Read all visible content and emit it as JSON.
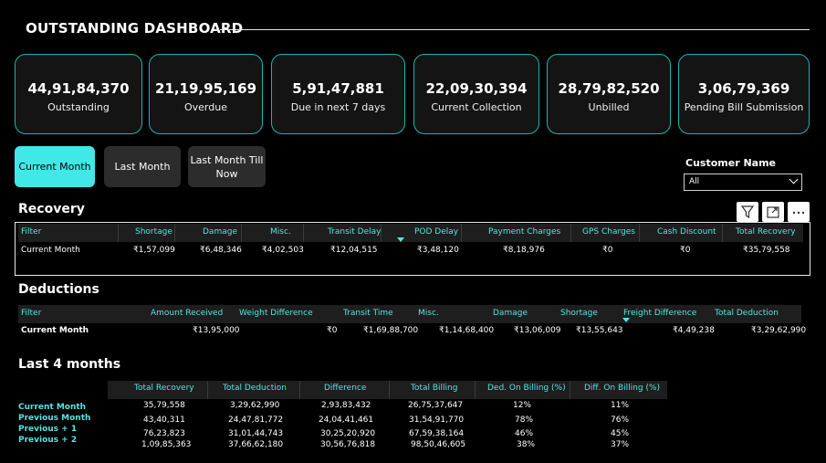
{
  "dashboard": {
    "title": "OUTSTANDING DASHBOARD"
  },
  "kpis": [
    {
      "value": "44,91,84,370",
      "label": "Outstanding"
    },
    {
      "value": "21,19,95,169",
      "label": "Overdue"
    },
    {
      "value": "5,91,47,881",
      "label": "Due in next 7 days"
    },
    {
      "value": "22,09,30,394",
      "label": "Current Collection"
    },
    {
      "value": "28,79,82,520",
      "label": "Unbilled"
    },
    {
      "value": "3,06,79,369",
      "label": "Pending Bill Submission"
    }
  ],
  "period_buttons": {
    "current": "Current Month",
    "last": "Last Month",
    "last_till_now_line1": "Last Month Till",
    "last_till_now_line2": "Now"
  },
  "slicer": {
    "label": "Customer Name",
    "value": "All"
  },
  "recovery": {
    "title": "Recovery",
    "headers": [
      "Filter",
      "Shortage",
      "Damage",
      "Misc.",
      "Transit Delay",
      "POD Delay",
      "Payment Charges",
      "GPS Charges",
      "Cash Discount",
      "Total Recovery"
    ],
    "row": [
      "Current Month",
      "₹1,57,099",
      "₹6,48,346",
      "₹4,02,503",
      "₹12,04,515",
      "₹3,48,120",
      "₹8,18,976",
      "₹0",
      "₹0",
      "₹35,79,558"
    ]
  },
  "deductions": {
    "title": "Deductions",
    "headers": [
      "Filter",
      "Amount Received",
      "Weight Difference",
      "Transit Time",
      "Misc.",
      "Damage",
      "Shortage",
      "Freight Difference",
      "Total Deduction"
    ],
    "row": [
      "Current Month",
      "₹13,95,000",
      "₹0",
      "₹1,69,88,700",
      "₹1,14,68,400",
      "₹13,06,009",
      "₹13,55,643",
      "₹4,49,238",
      "₹3,29,62,990"
    ]
  },
  "last4": {
    "title": "Last 4 months",
    "headers": [
      "Total Recovery",
      "Total Deduction",
      "Difference",
      "Total Billing",
      "Ded. On Billing (%)",
      "Diff. On Billing (%)"
    ],
    "row_labels": [
      "Current Month",
      "Previous Month",
      "Previous + 1",
      "Previous + 2"
    ],
    "rows": [
      [
        "35,79,558",
        "3,29,62,990",
        "2,93,83,432",
        "26,75,37,647",
        "12%",
        "11%"
      ],
      [
        "43,40,311",
        "24,47,81,772",
        "24,04,41,461",
        "31,54,91,770",
        "78%",
        "76%"
      ],
      [
        "76,23,823",
        "31,01,44,743",
        "30,25,20,920",
        "67,59,38,164",
        "46%",
        "45%"
      ],
      [
        "1,09,85,363",
        "37,66,62,180",
        "30,56,76,818",
        "98,50,46,605",
        "38%",
        "37%"
      ]
    ]
  },
  "icons": [
    "filter-icon",
    "focus-mode-icon",
    "more-options-icon"
  ]
}
